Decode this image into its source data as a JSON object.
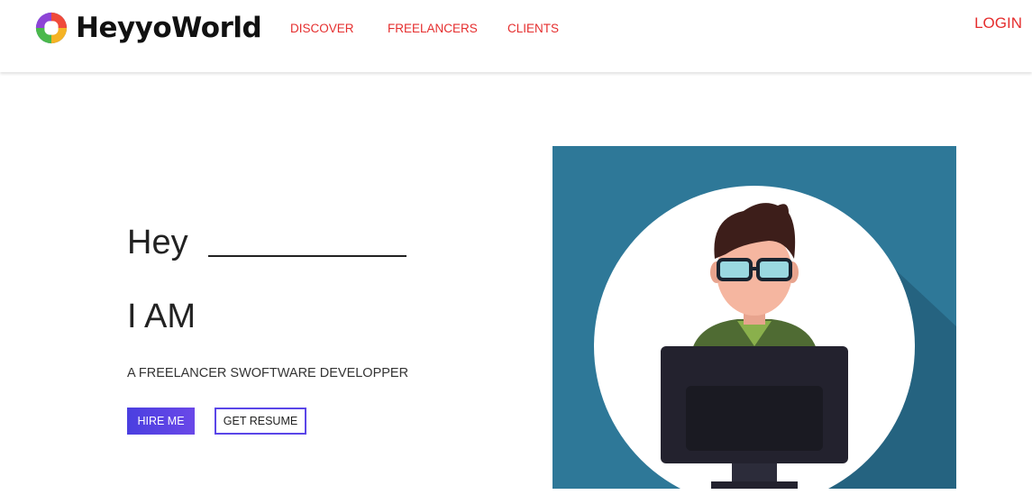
{
  "brand": {
    "name": "HeyyoWorld",
    "logo_icon": "heyyoworld-logo-icon"
  },
  "nav": {
    "links": [
      {
        "label": "DISCOVER"
      },
      {
        "label": "FREELANCERS"
      },
      {
        "label": "CLIENTS"
      }
    ],
    "login_label": "LOGIN",
    "link_color": "#e52e2e"
  },
  "hero": {
    "greeting": "Hey",
    "iam": "I AM",
    "role": "A FREELANCER SWOFTWARE DEVELOPPER",
    "hire_label": "HIRE ME",
    "resume_label": "GET RESUME",
    "illustration_icon": "developer-at-computer-illustration",
    "accent_color": "#4f42e3",
    "illustration_bg": "#2e7898"
  }
}
